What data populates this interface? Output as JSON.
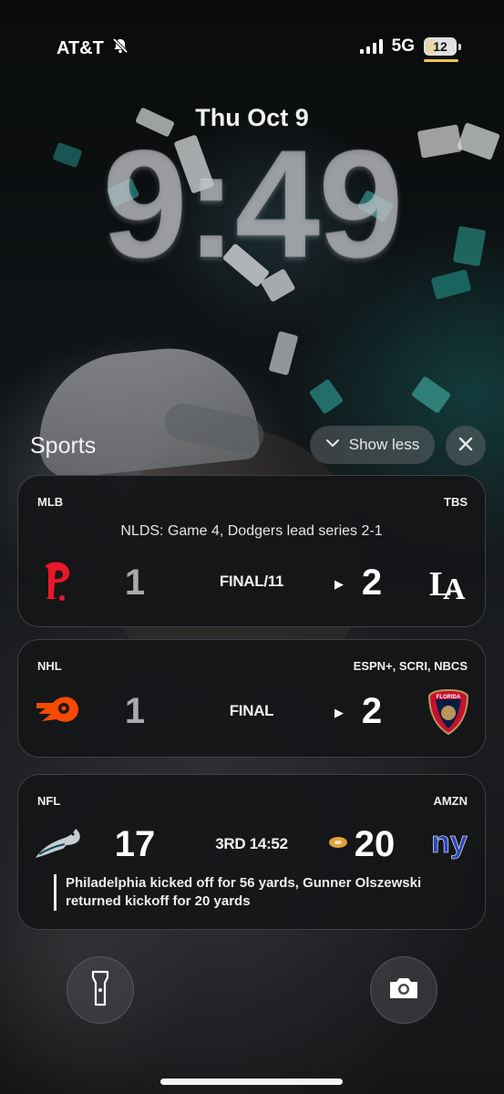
{
  "status_bar": {
    "carrier": "AT&T",
    "carrier_icon": "bell-slash-icon",
    "network": "5G",
    "battery": "12",
    "accent_color": "#f2c84b"
  },
  "lock_screen": {
    "date": "Thu Oct 9",
    "time": "9:49"
  },
  "sports": {
    "title": "Sports",
    "show_less_label": "Show less",
    "close_icon": "close-icon"
  },
  "cards": [
    {
      "league": "MLB",
      "network": "TBS",
      "headline": "NLDS: Game 4, Dodgers lead series 2-1",
      "home": {
        "team": "Phillies",
        "logo_text": "P",
        "score": "1",
        "color": "#e81828"
      },
      "away": {
        "team": "Dodgers",
        "logo_text": "LA",
        "score": "2"
      },
      "status": "FINAL/11"
    },
    {
      "league": "NHL",
      "network": "ESPN+, SCRI, NBCS",
      "home": {
        "team": "Flyers",
        "logo_text": "P",
        "score": "1",
        "color": "#f74902"
      },
      "away": {
        "team": "Panthers",
        "logo_text": "FLORIDA",
        "score": "2"
      },
      "status": "FINAL"
    },
    {
      "league": "NFL",
      "network": "AMZN",
      "home": {
        "team": "Eagles",
        "score": "17"
      },
      "away": {
        "team": "Giants",
        "logo_text": "ny",
        "score": "20",
        "color": "#1e3aa8"
      },
      "status": "3RD 14:52",
      "possession_icon": "football-icon",
      "play": "Philadelphia kicked off for 56 yards, Gunner Olszewski returned kickoff for 20 yards"
    }
  ],
  "bottom": {
    "flashlight_icon": "flashlight-icon",
    "camera_icon": "camera-icon"
  }
}
